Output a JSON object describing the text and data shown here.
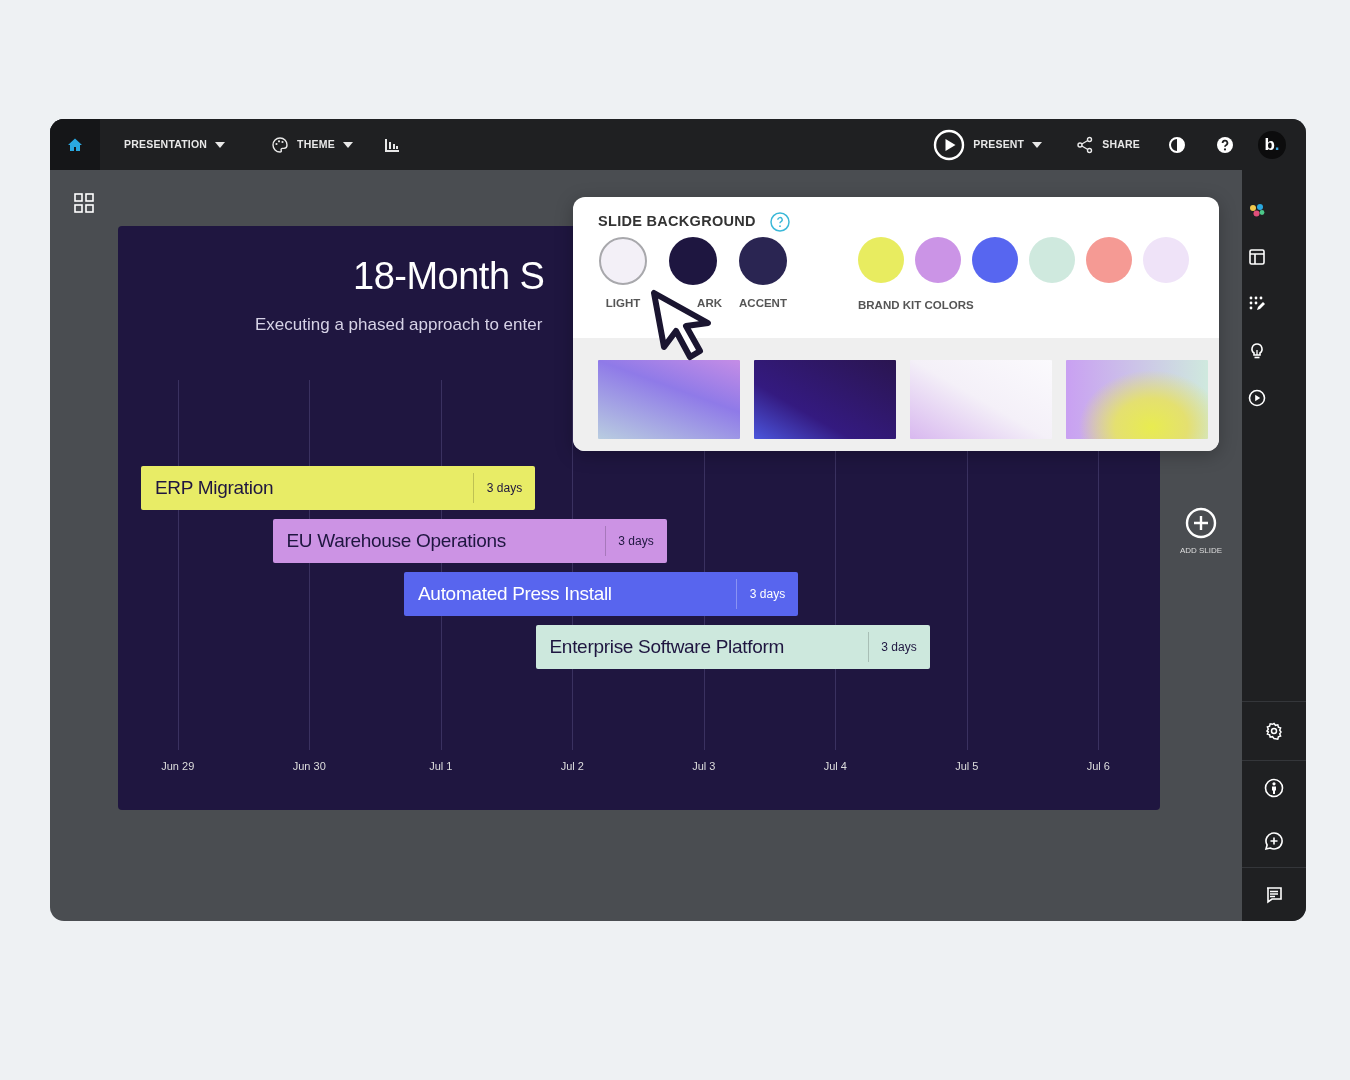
{
  "topbar": {
    "left": [
      {
        "kind": "home"
      },
      {
        "kind": "menu",
        "label": "PRESENTATION"
      },
      {
        "kind": "theme",
        "label": "THEME"
      },
      {
        "kind": "chart"
      }
    ],
    "right": [
      {
        "kind": "present",
        "label": "PRESENT"
      },
      {
        "kind": "share",
        "label": "SHARE"
      },
      {
        "kind": "contrast"
      },
      {
        "kind": "help"
      }
    ],
    "avatar": {
      "letter": "b",
      "dot": "."
    }
  },
  "slide": {
    "title": "18-Month S",
    "subtitle": "Executing a phased approach to enter",
    "tasks": [
      {
        "label": "ERP Migration",
        "duration": "3 days",
        "color": "#e8ec66"
      },
      {
        "label": "EU Warehouse Operations",
        "duration": "3 days",
        "color": "#cc93e4"
      },
      {
        "label": "Automated Press Install",
        "duration": "3 days",
        "color": "#5865ee"
      },
      {
        "label": "Enterprise Software Platform",
        "duration": "3 days",
        "color": "#cde8dd"
      }
    ],
    "axis": [
      "Jun 29",
      "Jun 30",
      "Jul 1",
      "Jul 2",
      "Jul 3",
      "Jul 4",
      "Jul 5",
      "Jul 6"
    ]
  },
  "add_slide": "ADD SLIDE",
  "popover": {
    "title": "SLIDE BACKGROUND",
    "theme_colors": [
      {
        "label": "LIGHT",
        "color": "#f3f0f7",
        "selected": true
      },
      {
        "label": "ARK",
        "color": "#1e1640",
        "selected": false
      },
      {
        "label": "ACCENT",
        "color": "#2a2552",
        "selected": false
      }
    ],
    "brand_kit": {
      "label": "BRAND KIT COLORS",
      "colors": [
        {
          "color": "#e8ec60",
          "selected": false
        },
        {
          "color": "#cb94e6",
          "selected": false
        },
        {
          "color": "#5766f0",
          "selected": false
        },
        {
          "color": "#cfe9de",
          "selected": false
        },
        {
          "color": "#f59a94",
          "selected": false
        },
        {
          "color": "#efe3f8",
          "selected": false
        }
      ]
    },
    "gradients": [
      {
        "kind": "violet"
      },
      {
        "kind": "midnight"
      },
      {
        "kind": "mist"
      },
      {
        "kind": "aurora"
      }
    ]
  },
  "sidebar": {
    "top": [
      {
        "kind": "palette"
      },
      {
        "kind": "layout"
      },
      {
        "kind": "grid-edit"
      },
      {
        "kind": "bulb"
      },
      {
        "kind": "play"
      }
    ],
    "bottom": [
      {
        "kind": "gear"
      },
      {
        "kind": "person"
      },
      {
        "kind": "comment-add"
      },
      {
        "kind": "notes"
      }
    ]
  }
}
